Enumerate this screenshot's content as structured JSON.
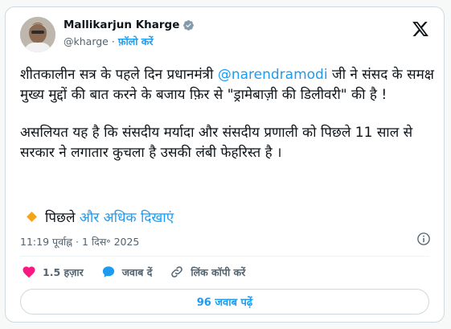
{
  "author": {
    "name": "Mallikarjun Kharge",
    "handle": "@kharge",
    "separator": "·",
    "follow_label": "फ़ॉलो करें"
  },
  "tweet": {
    "paragraph1_part1": "शीतकालीन सत्र के पहले दिन प्रधानमंत्री ",
    "mention": "@narendramodi",
    "paragraph1_part2": " जी ने संसद के समक्ष मुख्य मुद्दों की बात करने के बजाय फ़िर से \"ड्रामेबाज़ी की डिलीवरी\" की है !",
    "paragraph2": "असलियत यह है कि संसदीय मर्यादा और संसदीय प्रणाली को पिछले 11 साल से सरकार ने लगातार कुचला है उसकी लंबी फेहरिस्त है ।",
    "more_prefix": "पिछले",
    "more_link": "और अधिक दिखाएं"
  },
  "meta": {
    "time": "11:19 पूर्वाह्न",
    "separator": "·",
    "date": "1 दिस॰ 2025"
  },
  "actions": {
    "likes": "1.5 हज़ार",
    "reply_label": "जवाब दें",
    "copy_link_label": "लिंक कॉपी करें"
  },
  "replies_button": "96 जवाब पढ़ें",
  "colors": {
    "accent": "#1d9bf0",
    "like": "#f91880",
    "secondary_text": "#536471",
    "border": "#cfd9de",
    "more_diamond": "#f4a31b"
  },
  "icons": [
    "verified-badge-icon",
    "x-logo-icon",
    "info-icon",
    "heart-icon",
    "reply-bubble-icon",
    "link-icon",
    "diamond-icon"
  ]
}
